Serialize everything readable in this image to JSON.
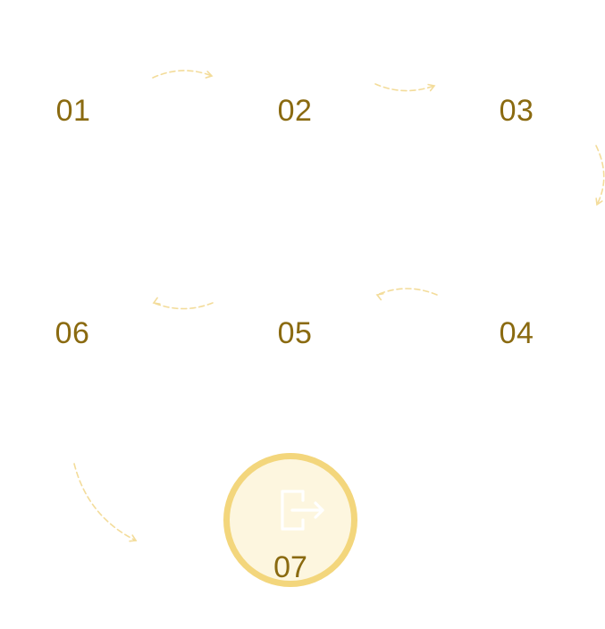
{
  "colors": {
    "label": "#8a6a10",
    "arrow": "#f3dc9a",
    "final_border": "#f3d67c",
    "final_fill": "#fdf6df",
    "icon_stroke": "#ffffff"
  },
  "steps": [
    {
      "label": "01"
    },
    {
      "label": "02"
    },
    {
      "label": "03"
    },
    {
      "label": "04"
    },
    {
      "label": "05"
    },
    {
      "label": "06"
    }
  ],
  "final_step": {
    "label": "07",
    "icon": "exit-icon"
  },
  "connectors": [
    {
      "from": "01",
      "to": "02"
    },
    {
      "from": "02",
      "to": "03"
    },
    {
      "from": "03",
      "to": "04"
    },
    {
      "from": "04",
      "to": "05"
    },
    {
      "from": "05",
      "to": "06"
    },
    {
      "from": "06",
      "to": "07"
    }
  ]
}
